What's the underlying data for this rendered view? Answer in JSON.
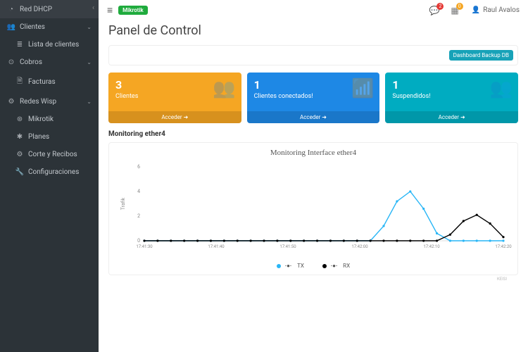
{
  "sidebar": {
    "items": [
      {
        "label": "Red DHCP",
        "icon": "◔"
      },
      {
        "label": "Clientes",
        "icon": "👥",
        "chev": "⌄"
      },
      {
        "label": "Lista de clientes",
        "icon": "≣",
        "sub": true
      },
      {
        "label": "Cobros",
        "icon": "⊙",
        "chev": "⌄"
      },
      {
        "label": "Facturas",
        "icon": "🗎",
        "sub": true
      },
      {
        "label": "Redes Wisp",
        "icon": "⚙",
        "chev": "⌄"
      },
      {
        "label": "Mikrotik",
        "icon": "⊛",
        "sub": true
      },
      {
        "label": "Planes",
        "icon": "✱",
        "sub": true
      },
      {
        "label": "Corte y Recibos",
        "icon": "⚙",
        "sub": true
      },
      {
        "label": "Configuraciones",
        "icon": "🔧",
        "sub": true
      }
    ]
  },
  "topbar": {
    "badge": "Mikrotik",
    "notif1": "2",
    "notif2": "0",
    "user": "Raul Avalos"
  },
  "page": {
    "title": "Panel de Control",
    "backup_btn": "Dashboard Backup DB"
  },
  "cards": [
    {
      "num": "3",
      "label": "Clientes",
      "action": "Acceder",
      "color": "y",
      "icon": "👥"
    },
    {
      "num": "1",
      "label": "Clientes conectados!",
      "action": "Acceder",
      "color": "b",
      "icon": "📶"
    },
    {
      "num": "1",
      "label": "Suspendidos!",
      "action": "Acceder",
      "color": "t",
      "icon": "👥"
    }
  ],
  "chart": {
    "heading": "Monitoring ether4",
    "title": "Monitoring Interface ether4",
    "ylabel": "Trafik",
    "legend_tx": "TX",
    "legend_rx": "RX",
    "credit": "KEISI"
  },
  "chart_data": {
    "type": "line",
    "title": "Monitoring Interface ether4",
    "xlabel": "",
    "ylabel": "Trafik",
    "ylim": [
      0,
      6
    ],
    "x_ticks": [
      "17:41:30",
      "17:41:40",
      "17:41:50",
      "17:42:00",
      "17:42:10",
      "17:42:20"
    ],
    "categories": [
      "17:41:28",
      "17:41:30",
      "17:41:32",
      "17:41:34",
      "17:41:36",
      "17:41:38",
      "17:41:40",
      "17:41:42",
      "17:41:44",
      "17:41:46",
      "17:41:48",
      "17:41:50",
      "17:41:52",
      "17:41:54",
      "17:41:56",
      "17:41:58",
      "17:42:00",
      "17:42:02",
      "17:42:04",
      "17:42:06",
      "17:42:08",
      "17:42:10",
      "17:42:12",
      "17:42:14",
      "17:42:16",
      "17:42:18",
      "17:42:20",
      "17:42:22"
    ],
    "series": [
      {
        "name": "TX",
        "color": "#29b6f6",
        "values": [
          0,
          0,
          0,
          0,
          0,
          0,
          0,
          0,
          0,
          0,
          0,
          0,
          0,
          0,
          0,
          0,
          0,
          0,
          1.2,
          3.2,
          4.0,
          2.6,
          0.6,
          0,
          0,
          0,
          0,
          0
        ]
      },
      {
        "name": "RX",
        "color": "#000000",
        "values": [
          0,
          0,
          0,
          0,
          0,
          0,
          0,
          0,
          0,
          0,
          0,
          0,
          0,
          0,
          0,
          0,
          0,
          0,
          0,
          0,
          0,
          0,
          0,
          0.5,
          1.6,
          2.1,
          1.4,
          0.3
        ]
      }
    ]
  }
}
